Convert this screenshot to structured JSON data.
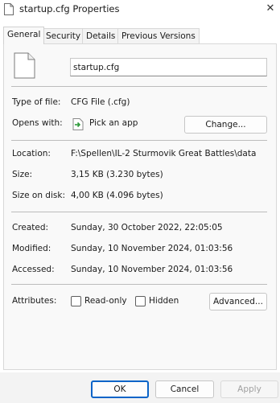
{
  "window": {
    "title": "startup.cfg Properties",
    "close_symbol": "✕"
  },
  "tabs": [
    {
      "label": "General",
      "active": true
    },
    {
      "label": "Security",
      "active": false
    },
    {
      "label": "Details",
      "active": false
    },
    {
      "label": "Previous Versions",
      "active": false
    }
  ],
  "general": {
    "file_name": "startup.cfg",
    "type_label": "Type of file:",
    "type_value": "CFG File (.cfg)",
    "opens_label": "Opens with:",
    "opens_value": "Pick an app",
    "change_button": "Change...",
    "location_label": "Location:",
    "location_value": "F:\\Spellen\\IL-2 Sturmovik Great Battles\\data",
    "size_label": "Size:",
    "size_value": "3,15 KB (3.230 bytes)",
    "size_on_disk_label": "Size on disk:",
    "size_on_disk_value": "4,00 KB (4.096 bytes)",
    "created_label": "Created:",
    "created_value": "Sunday, 30 October 2022, 22:05:05",
    "modified_label": "Modified:",
    "modified_value": "Sunday, 10 November 2024, 01:03:56",
    "accessed_label": "Accessed:",
    "accessed_value": "Sunday, 10 November 2024, 01:03:56",
    "attributes_label": "Attributes:",
    "readonly_label": "Read-only",
    "readonly_checked": false,
    "hidden_label": "Hidden",
    "hidden_checked": false,
    "advanced_button": "Advanced..."
  },
  "footer": {
    "ok_button": "OK",
    "cancel_button": "Cancel",
    "apply_button": "Apply"
  },
  "colors": {
    "accent": "#0a64c8",
    "panel_bg": "#f9f9f9",
    "footer_bg": "#f3f3f3"
  }
}
